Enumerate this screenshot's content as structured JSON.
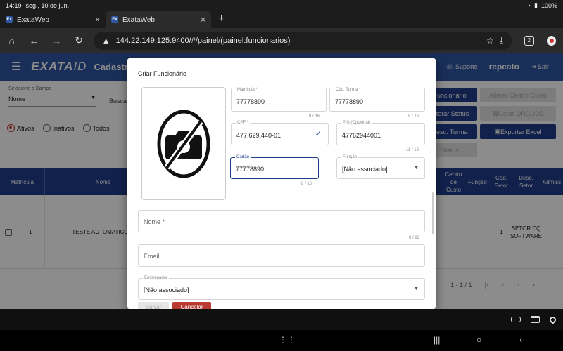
{
  "status_bar": {
    "time": "14:19",
    "date": "seg., 10 de jun.",
    "battery": "100%"
  },
  "browser": {
    "tabs": [
      {
        "title": "ExataWeb",
        "favicon": "Ex",
        "active": false
      },
      {
        "title": "ExataWeb",
        "favicon": "Ex",
        "active": true
      }
    ],
    "url": "144.22.149.125:9400/#/painel/(painel:funcionarios)",
    "tab_count": "2"
  },
  "app": {
    "logo_main": "EXATA",
    "logo_suffix": "ID",
    "page_title": "Cadastro",
    "suporte_label": "Suporte",
    "user": "repeato",
    "sair_label": "Sair",
    "brand_color": "#2f57a3"
  },
  "background": {
    "campo_label": "Selecione o Campo",
    "campo_value": "Nome",
    "buscar_label": "Buscar",
    "radios": [
      {
        "label": "Ativos",
        "checked": true
      },
      {
        "label": "Inativos",
        "checked": false
      },
      {
        "label": "Todos",
        "checked": false
      }
    ],
    "actions": {
      "funcionario": "Funcionário",
      "alterar_centro_custo": "Alterar Centro Custo",
      "alterar_status": "Alterar Status",
      "gerar_qrcode": "Gerar QRCODE",
      "desc_turma": "Desc. Turma",
      "exportar_excel": "Exportar Excel",
      "status": "Status"
    },
    "table": {
      "headers": {
        "matricula": "Matrícula",
        "nome": "Nome",
        "centro_custo": "Centro de Custo",
        "funcao": "Função",
        "cod_setor": "Cód. Setor",
        "desc_setor": "Desc. Setor",
        "admissao": "Admiss"
      },
      "row": {
        "matricula": "1",
        "nome": "TESTE AUTOMATICO R",
        "cod_setor": "1",
        "desc_setor": "SETOR CQ SOFTWARE"
      }
    },
    "pager": "1 - 1 / 1"
  },
  "dialog": {
    "title": "Criar Funcionário",
    "fields": {
      "matricula": {
        "label": "Matrícula *",
        "value": "77778890",
        "hint": "8 / 16"
      },
      "cod_turma": {
        "label": "Cód. Turma *",
        "value": "77778890",
        "hint": "8 / 16"
      },
      "cpf": {
        "label": "CPF *",
        "value": "477.629.440-01"
      },
      "pis": {
        "label": "PIS (Opcional)",
        "value": "47762944001",
        "hint": "11 / 12"
      },
      "cartao": {
        "label": "Cartão",
        "value": "77778890",
        "hint": "8 / 16"
      },
      "funcao": {
        "label": "Função",
        "value": "[Não associado]"
      },
      "nome": {
        "placeholder": "Nome *",
        "hint": "0 / 82"
      },
      "email": {
        "placeholder": "Email"
      },
      "empregador": {
        "label": "Empregador",
        "value": "[Não associado]"
      }
    },
    "salvar_label": "Salvar",
    "cancelar_label": "Cancelar"
  }
}
